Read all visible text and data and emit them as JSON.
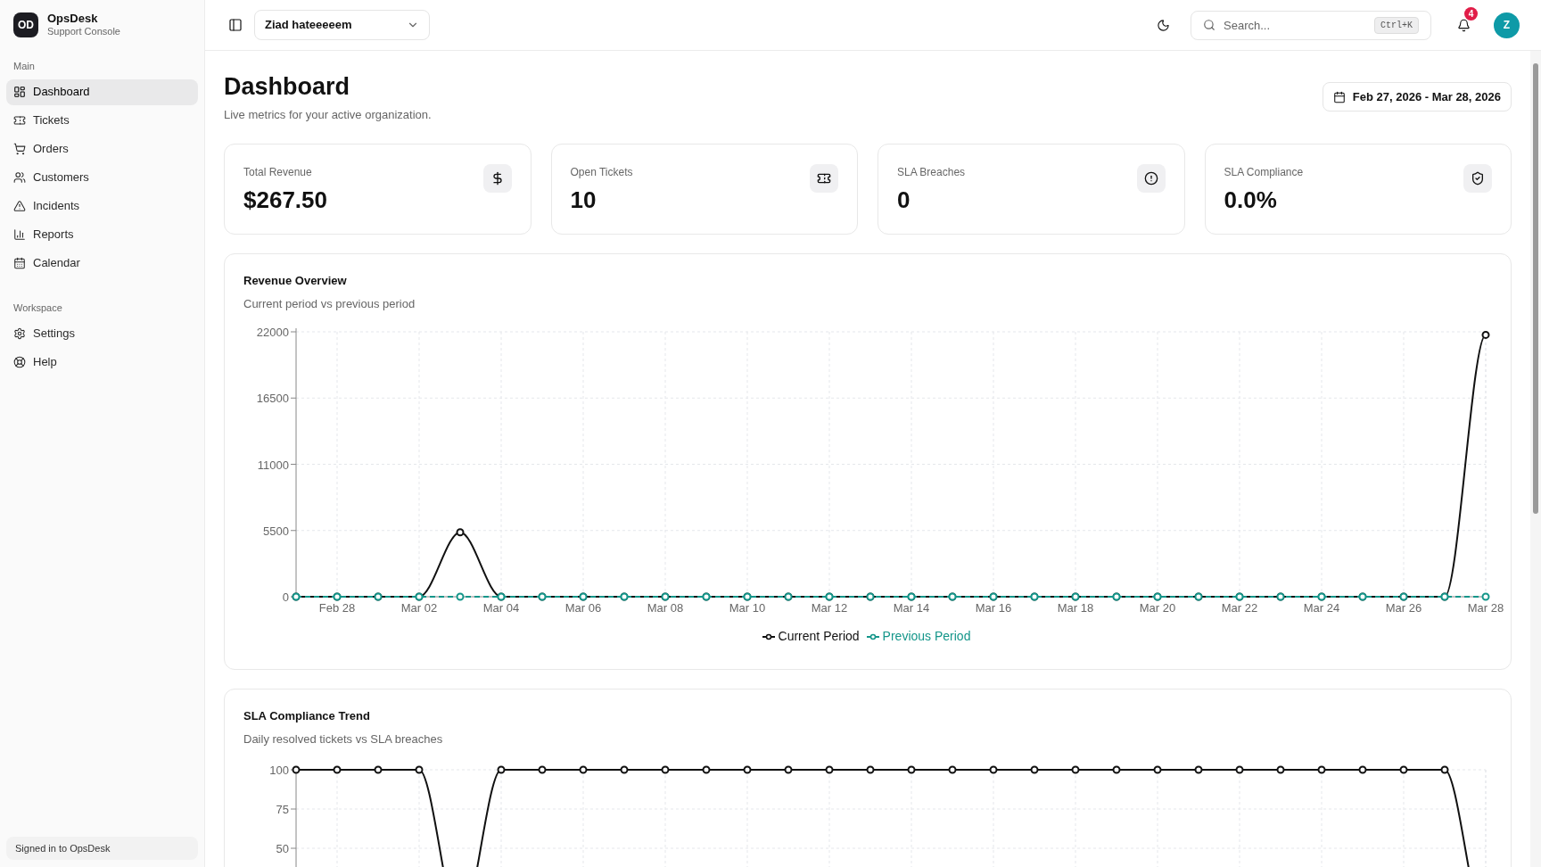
{
  "sidebar": {
    "brand": {
      "logo": "OD",
      "name": "OpsDesk",
      "subtitle": "Support Console"
    },
    "sections": [
      {
        "title": "Main",
        "items": [
          {
            "label": "Dashboard",
            "selected": true
          },
          {
            "label": "Tickets",
            "selected": false
          },
          {
            "label": "Orders",
            "selected": false
          },
          {
            "label": "Customers",
            "selected": false
          },
          {
            "label": "Incidents",
            "selected": false
          },
          {
            "label": "Reports",
            "selected": false
          },
          {
            "label": "Calendar",
            "selected": false
          }
        ]
      },
      {
        "title": "Workspace",
        "items": [
          {
            "label": "Settings",
            "selected": false
          },
          {
            "label": "Help",
            "selected": false
          }
        ]
      }
    ],
    "footer": "Signed in to OpsDesk"
  },
  "header": {
    "organization": "Ziad hateeeeem",
    "search": {
      "placeholder": "Search...",
      "shortcut": "Ctrl+K"
    },
    "notifications": "4",
    "avatar": "Z"
  },
  "page": {
    "title": "Dashboard",
    "subtitle": "Live metrics for your active organization.",
    "date_range": "Feb 27, 2026 - Mar 28, 2026"
  },
  "stats": [
    {
      "label": "Total Revenue",
      "value": "$267.50"
    },
    {
      "label": "Open Tickets",
      "value": "10"
    },
    {
      "label": "SLA Breaches",
      "value": "0"
    },
    {
      "label": "SLA Compliance",
      "value": "0.0%"
    }
  ],
  "charts": [
    {
      "title": "Revenue Overview",
      "subtitle": "Current period vs previous period",
      "chart_data": {
        "type": "line",
        "categories": [
          null,
          "Feb 28",
          null,
          "Mar 02",
          null,
          "Mar 04",
          null,
          "Mar 06",
          null,
          "Mar 08",
          null,
          "Mar 10",
          null,
          "Mar 12",
          null,
          "Mar 14",
          null,
          "Mar 16",
          null,
          "Mar 18",
          null,
          "Mar 20",
          null,
          "Mar 22",
          null,
          "Mar 24",
          null,
          "Mar 26",
          null,
          "Mar 28"
        ],
        "series": [
          {
            "name": "Current Period",
            "color": "#111111",
            "marker": "circle",
            "line_style": "solid",
            "values": [
              0,
              0,
              0,
              0,
              5350,
              0,
              0,
              0,
              0,
              0,
              0,
              0,
              0,
              0,
              0,
              0,
              0,
              0,
              0,
              0,
              0,
              0,
              0,
              0,
              0,
              0,
              0,
              0,
              0,
              21750
            ]
          },
          {
            "name": "Previous Period",
            "color": "#14968a",
            "marker": "circle",
            "line_style": "dashed",
            "values": [
              0,
              0,
              0,
              0,
              0,
              0,
              0,
              0,
              0,
              0,
              0,
              0,
              0,
              0,
              0,
              0,
              0,
              0,
              0,
              0,
              0,
              0,
              0,
              0,
              0,
              0,
              0,
              0,
              0,
              0
            ]
          }
        ],
        "ylim": [
          0,
          22000
        ],
        "yticks": [
          {
            "value": 0,
            "label": "0"
          },
          5500,
          11000,
          16500,
          22000
        ],
        "grid": true,
        "legend": true
      }
    },
    {
      "title": "SLA Compliance Trend",
      "subtitle": "Daily resolved tickets vs SLA breaches",
      "chart_data": {
        "type": "line",
        "series": [
          {
            "color": "#111111",
            "marker": "circle",
            "line_style": "solid",
            "values": [
              100,
              100,
              100,
              100,
              0,
              100,
              100,
              100,
              100,
              100,
              100,
              100,
              100,
              100,
              100,
              100,
              100,
              100,
              100,
              100,
              100,
              100,
              100,
              100,
              100,
              100,
              100,
              100,
              100,
              0
            ]
          }
        ],
        "ylim": [
          0,
          100
        ],
        "yticks": [
          50,
          75,
          100
        ],
        "grid": true
      }
    }
  ]
}
